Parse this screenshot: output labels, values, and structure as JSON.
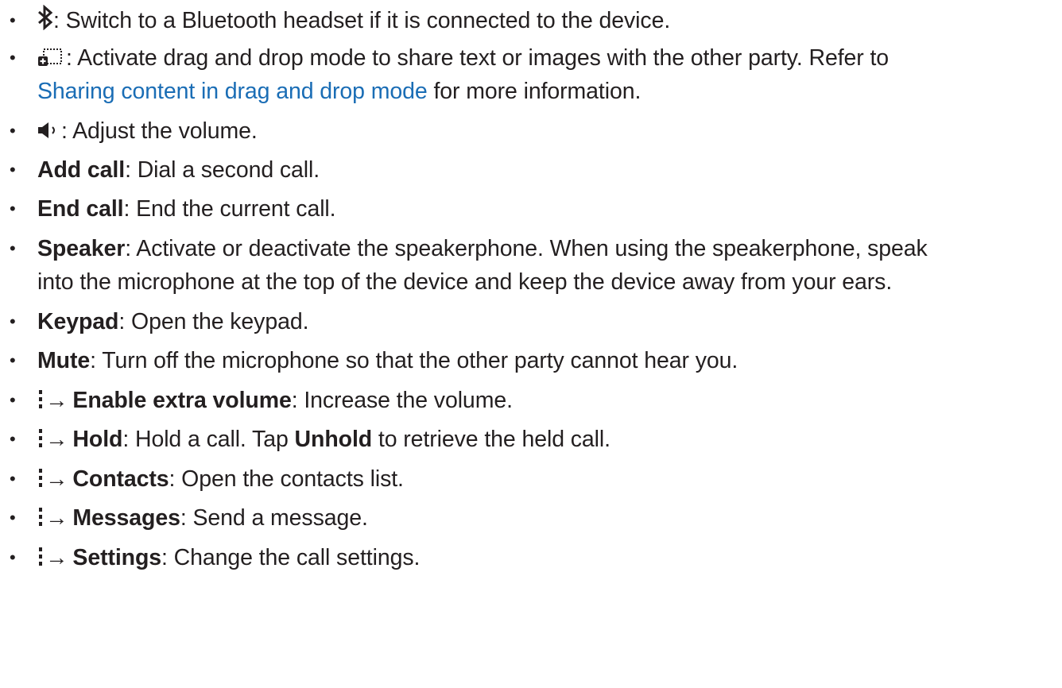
{
  "items": [
    {
      "icon": "bluetooth-icon",
      "text": ": Switch to a Bluetooth headset if it is connected to the device."
    },
    {
      "icon": "drag-drop-icon",
      "text": ": Activate drag and drop mode to share text or images with the other party. Refer to",
      "link": "Sharing content in drag and drop mode",
      "text2": " for more information."
    },
    {
      "icon": "volume-icon",
      "text": ": Adjust the volume."
    },
    {
      "label": "Add call",
      "text": ": Dial a second call."
    },
    {
      "label": "End call",
      "text": ": End the current call."
    },
    {
      "label": "Speaker",
      "text": ": Activate or deactivate the speakerphone. When using the speakerphone, speak",
      "text2": "into the microphone at the top of the device and keep the device away from your ears."
    },
    {
      "label": "Keypad",
      "text": ": Open the keypad."
    },
    {
      "label": "Mute",
      "text": ": Turn off the microphone so that the other party cannot hear you."
    },
    {
      "icon": "more-options-icon",
      "arrow": "→",
      "label": "Enable extra volume",
      "text": ": Increase the volume."
    },
    {
      "icon": "more-options-icon",
      "arrow": "→",
      "label": "Hold",
      "text": ": Hold a call. Tap ",
      "label2": "Unhold",
      "text2": " to retrieve the held call."
    },
    {
      "icon": "more-options-icon",
      "arrow": "→",
      "label": "Contacts",
      "text": ": Open the contacts list."
    },
    {
      "icon": "more-options-icon",
      "arrow": "→",
      "label": "Messages",
      "text": ": Send a message."
    },
    {
      "icon": "more-options-icon",
      "arrow": "→",
      "label": "Settings",
      "text": ": Change the call settings."
    }
  ],
  "bullet": "•",
  "colors": {
    "text": "#231f20",
    "link": "#1a6db5"
  }
}
